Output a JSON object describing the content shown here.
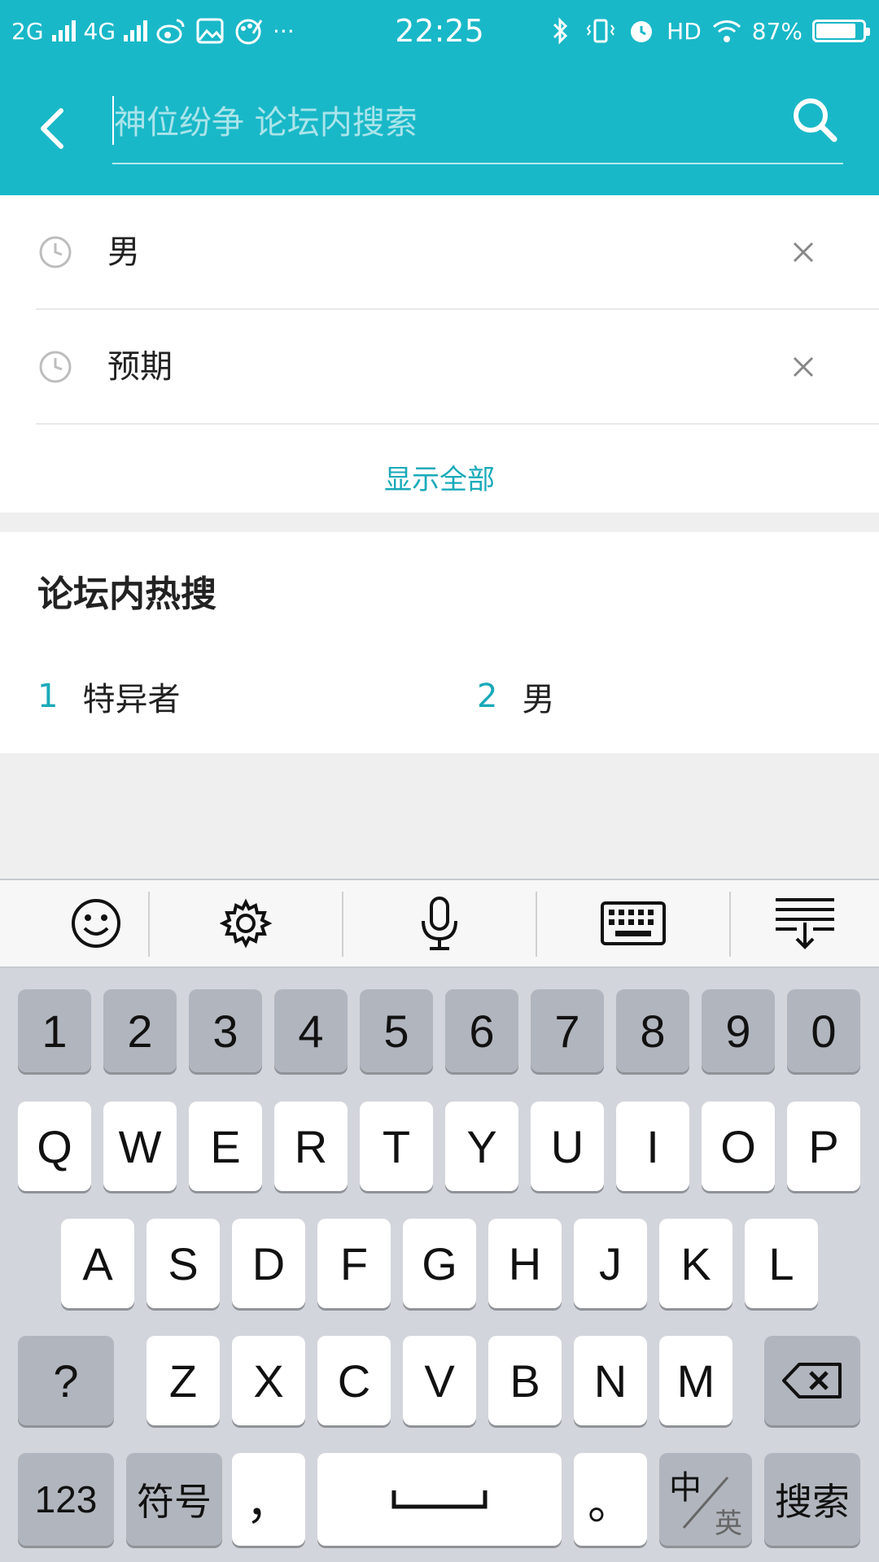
{
  "status_bar": {
    "network_1": "2G",
    "network_2": "4G",
    "more": "···",
    "time": "22:25",
    "hd": "HD",
    "battery": "87%"
  },
  "search": {
    "placeholder": "神位纷争 论坛内搜索"
  },
  "history": {
    "items": [
      {
        "text": "男"
      },
      {
        "text": "预期"
      }
    ],
    "show_all": "显示全部"
  },
  "hot_search": {
    "title": "论坛内热搜",
    "items": [
      {
        "rank": "1",
        "text": "特异者"
      },
      {
        "rank": "2",
        "text": "男"
      }
    ]
  },
  "keyboard": {
    "row_numbers": [
      "1",
      "2",
      "3",
      "4",
      "5",
      "6",
      "7",
      "8",
      "9",
      "0"
    ],
    "row_1": [
      "Q",
      "W",
      "E",
      "R",
      "T",
      "Y",
      "U",
      "I",
      "O",
      "P"
    ],
    "row_2": [
      "A",
      "S",
      "D",
      "F",
      "G",
      "H",
      "J",
      "K",
      "L"
    ],
    "row_3": [
      "Z",
      "X",
      "C",
      "V",
      "B",
      "N",
      "M"
    ],
    "question": "?",
    "num_key": "123",
    "symbol_key": "符号",
    "comma": "，",
    "period": "。",
    "lang_zh": "中",
    "lang_en": "英",
    "search_key": "搜索"
  },
  "colors": {
    "accent": "#19b8c8",
    "accent_text": "#19aab9",
    "keyboard_bg": "#d2d5db"
  }
}
